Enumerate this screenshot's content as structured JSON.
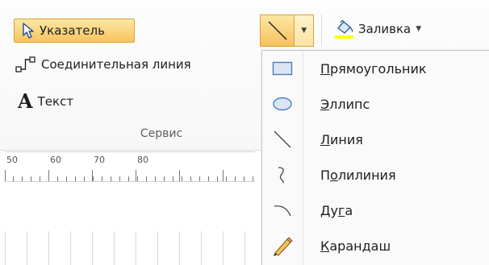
{
  "tools": {
    "pointer_label": "Указатель",
    "connector_label": "Соединительная линия",
    "text_label": "Текст",
    "text_icon_glyph": "A",
    "group_label": "Сервис"
  },
  "fill": {
    "label": "Заливка",
    "fill_color": "#ffff00"
  },
  "ruler": {
    "marks": [
      "50",
      "60",
      "70",
      "80"
    ]
  },
  "shape_menu": {
    "items": [
      {
        "label": "Прямоугольник",
        "accel": "П",
        "rest": "рямоугольник",
        "icon": "rectangle-icon"
      },
      {
        "label": "Эллипс",
        "accel": "Э",
        "rest": "ллипс",
        "icon": "ellipse-icon"
      },
      {
        "label": "Линия",
        "accel": "Л",
        "rest": "иния",
        "icon": "line-icon"
      },
      {
        "label": "Полилиния",
        "pre": "П",
        "accel": "о",
        "rest": "лилиния",
        "icon": "polyline-icon"
      },
      {
        "label": "Дуга",
        "pre": "Ду",
        "accel": "г",
        "rest": "а",
        "icon": "arc-icon"
      },
      {
        "label": "Карандаш",
        "accel": "К",
        "rest": "арандаш",
        "icon": "pencil-icon"
      }
    ]
  },
  "colors": {
    "highlight": "#f8c45e",
    "accent_blue": "#4a7ebb",
    "shape_fill": "#dbe6f5"
  }
}
